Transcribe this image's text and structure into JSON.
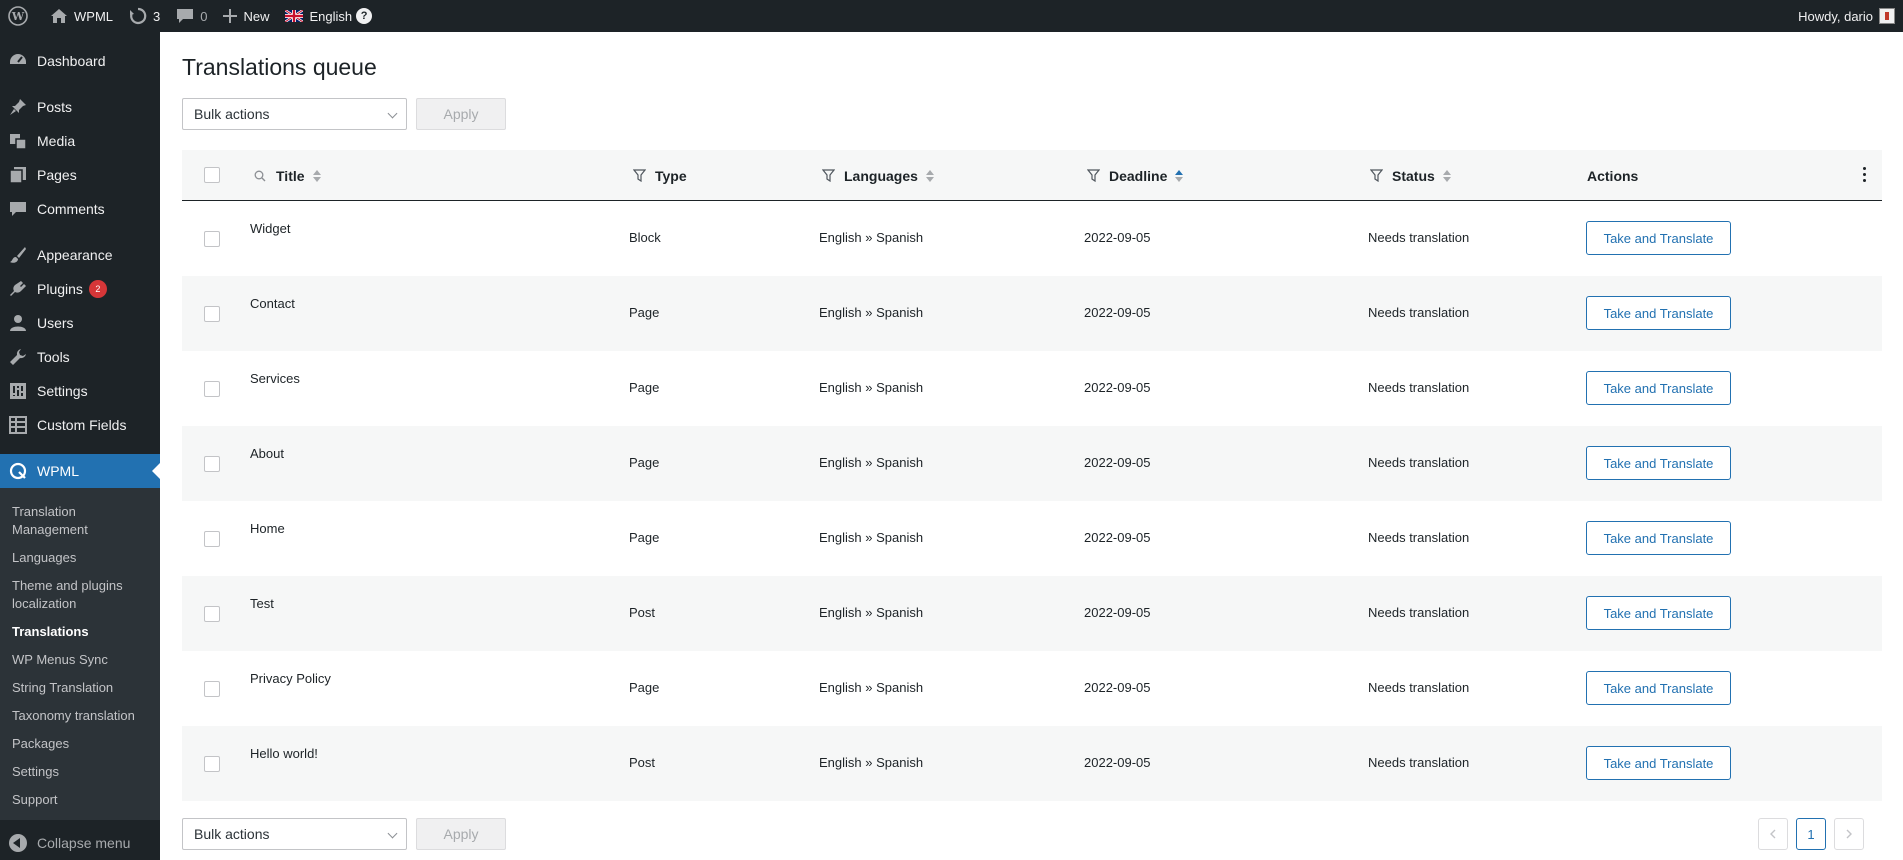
{
  "adminbar": {
    "site_name": "WPML",
    "updates_count": "3",
    "comments_count": "0",
    "new_label": "New",
    "language": "English",
    "help": "?",
    "greeting": "Howdy, dario"
  },
  "sidebar": {
    "items": [
      {
        "label": "Dashboard",
        "icon": "dashboard-icon"
      },
      {
        "label": "Posts",
        "icon": "pin-icon"
      },
      {
        "label": "Media",
        "icon": "media-icon"
      },
      {
        "label": "Pages",
        "icon": "pages-icon"
      },
      {
        "label": "Comments",
        "icon": "comments-icon"
      },
      {
        "label": "Appearance",
        "icon": "brush-icon"
      },
      {
        "label": "Plugins",
        "icon": "plugin-icon",
        "badge": "2"
      },
      {
        "label": "Users",
        "icon": "user-icon"
      },
      {
        "label": "Tools",
        "icon": "wrench-icon"
      },
      {
        "label": "Settings",
        "icon": "settings-icon"
      },
      {
        "label": "Custom Fields",
        "icon": "grid-icon"
      },
      {
        "label": "WPML",
        "icon": "wpml-icon"
      }
    ],
    "submenu": [
      "Translation Management",
      "Languages",
      "Theme and plugins localization",
      "Translations",
      "WP Menus Sync",
      "String Translation",
      "Taxonomy translation",
      "Packages",
      "Settings",
      "Support"
    ],
    "collapse_label": "Collapse menu"
  },
  "page": {
    "title": "Translations queue",
    "bulk_actions": "Bulk actions",
    "apply": "Apply"
  },
  "table": {
    "headers": {
      "title": "Title",
      "type": "Type",
      "languages": "Languages",
      "deadline": "Deadline",
      "status": "Status",
      "actions": "Actions"
    },
    "rows": [
      {
        "title": "Widget",
        "type": "Block",
        "languages": "English » Spanish",
        "deadline": "2022-09-05",
        "status": "Needs translation",
        "action": "Take and Translate"
      },
      {
        "title": "Contact",
        "type": "Page",
        "languages": "English » Spanish",
        "deadline": "2022-09-05",
        "status": "Needs translation",
        "action": "Take and Translate"
      },
      {
        "title": "Services",
        "type": "Page",
        "languages": "English » Spanish",
        "deadline": "2022-09-05",
        "status": "Needs translation",
        "action": "Take and Translate"
      },
      {
        "title": "About",
        "type": "Page",
        "languages": "English » Spanish",
        "deadline": "2022-09-05",
        "status": "Needs translation",
        "action": "Take and Translate"
      },
      {
        "title": "Home",
        "type": "Page",
        "languages": "English » Spanish",
        "deadline": "2022-09-05",
        "status": "Needs translation",
        "action": "Take and Translate"
      },
      {
        "title": "Test",
        "type": "Post",
        "languages": "English » Spanish",
        "deadline": "2022-09-05",
        "status": "Needs translation",
        "action": "Take and Translate"
      },
      {
        "title": "Privacy Policy",
        "type": "Page",
        "languages": "English » Spanish",
        "deadline": "2022-09-05",
        "status": "Needs translation",
        "action": "Take and Translate"
      },
      {
        "title": "Hello world!",
        "type": "Post",
        "languages": "English » Spanish",
        "deadline": "2022-09-05",
        "status": "Needs translation",
        "action": "Take and Translate"
      }
    ]
  },
  "pagination": {
    "current_page": "1"
  }
}
